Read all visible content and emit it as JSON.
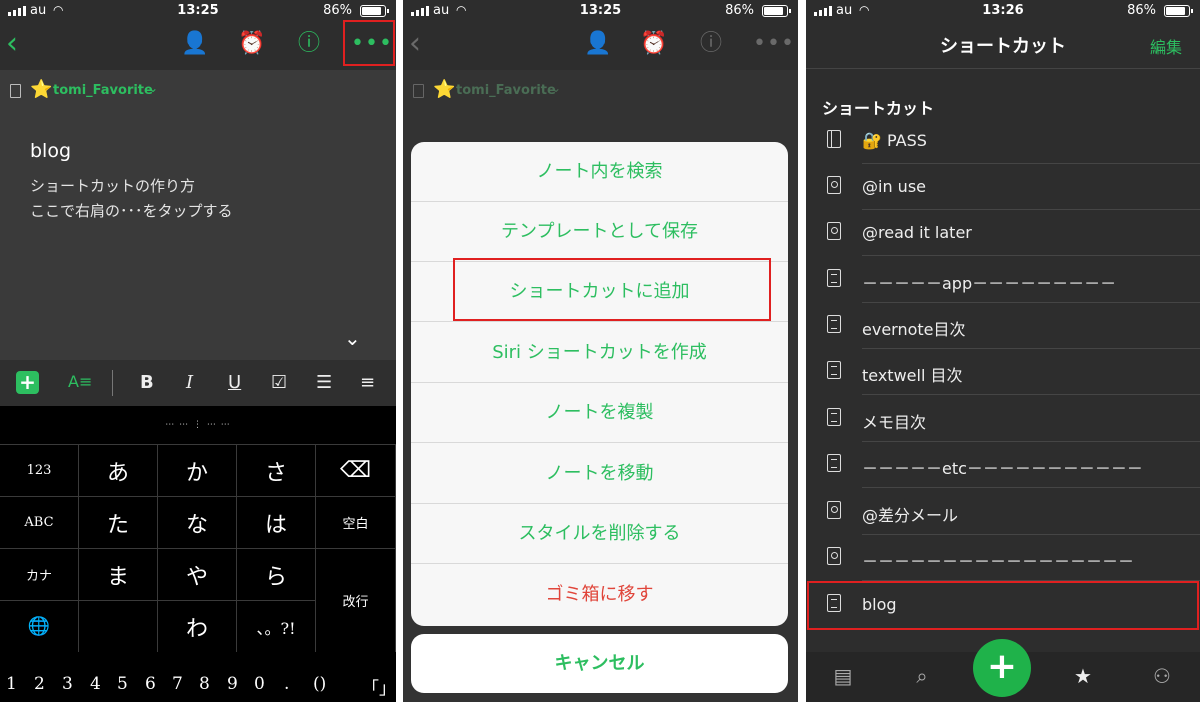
{
  "status": {
    "carrier": "au",
    "battery": "86%",
    "times": [
      "13:25",
      "13:25",
      "13:26"
    ]
  },
  "editor": {
    "nav": {
      "back_icon": "chevron-left-icon",
      "icons": [
        "add-person-icon",
        "alarm-icon",
        "info-icon",
        "more-icon"
      ]
    },
    "notebook": {
      "name": "tomi_Favorite",
      "star": "⭐"
    },
    "note": {
      "title": "blog",
      "lines": [
        "ショートカットの作り方",
        "ここで右肩の･･･をタップする"
      ]
    },
    "toolbar": [
      "+",
      "A≡",
      "B",
      "I",
      "U",
      "☑",
      "☰",
      "≡"
    ],
    "keyboard": {
      "suggest": "⋯ ⋯ ⋮ ⋯ ⋯",
      "rows": [
        [
          "123",
          "あ",
          "か",
          "さ",
          "⌫"
        ],
        [
          "ABC",
          "た",
          "な",
          "は",
          "空白"
        ],
        [
          "カナ",
          "ま",
          "や",
          "ら",
          "改行"
        ],
        [
          "🌐",
          "",
          "わ",
          "、。?!"
        ]
      ],
      "numbers": [
        "1",
        "2",
        "3",
        "4",
        "5",
        "6",
        "7",
        "8",
        "9",
        "0",
        ".",
        "()",
        "「」"
      ]
    }
  },
  "menu": {
    "notebook": {
      "name": "tomi_Favorite"
    },
    "items": [
      "ノート内を検索",
      "テンプレートとして保存",
      "ショートカットに追加",
      "Siri ショートカットを作成",
      "ノートを複製",
      "ノートを移動",
      "スタイルを削除する",
      "ゴミ箱に移す"
    ],
    "cancel": "キャンセル"
  },
  "shortcuts": {
    "title": "ショートカット",
    "edit": "編集",
    "section": "ショートカット",
    "items": [
      {
        "icon": "notebook-icon",
        "label": "🔐 PASS"
      },
      {
        "icon": "tag-icon",
        "label": "@in use"
      },
      {
        "icon": "tag-icon",
        "label": "@read it later"
      },
      {
        "icon": "note-icon",
        "label": "－－－－－app－－－－－－－－－"
      },
      {
        "icon": "note-icon",
        "label": "evernote目次"
      },
      {
        "icon": "note-icon",
        "label": "textwell 目次"
      },
      {
        "icon": "note-icon",
        "label": "メモ目次"
      },
      {
        "icon": "note-icon",
        "label": "－－－－－etc－－－－－－－－－－－"
      },
      {
        "icon": "tag-icon",
        "label": "@差分メール"
      },
      {
        "icon": "tag-icon",
        "label": "－－－－－－－－－－－－－－－－－"
      },
      {
        "icon": "note-icon",
        "label": "blog"
      }
    ],
    "tabs": [
      "notes-icon",
      "search-icon",
      "new-note-icon",
      "shortcuts-icon",
      "account-icon"
    ],
    "fab": "+"
  },
  "colors": {
    "accent": "#2dbe60",
    "highlight": "#e02020",
    "danger": "#e0453a"
  }
}
